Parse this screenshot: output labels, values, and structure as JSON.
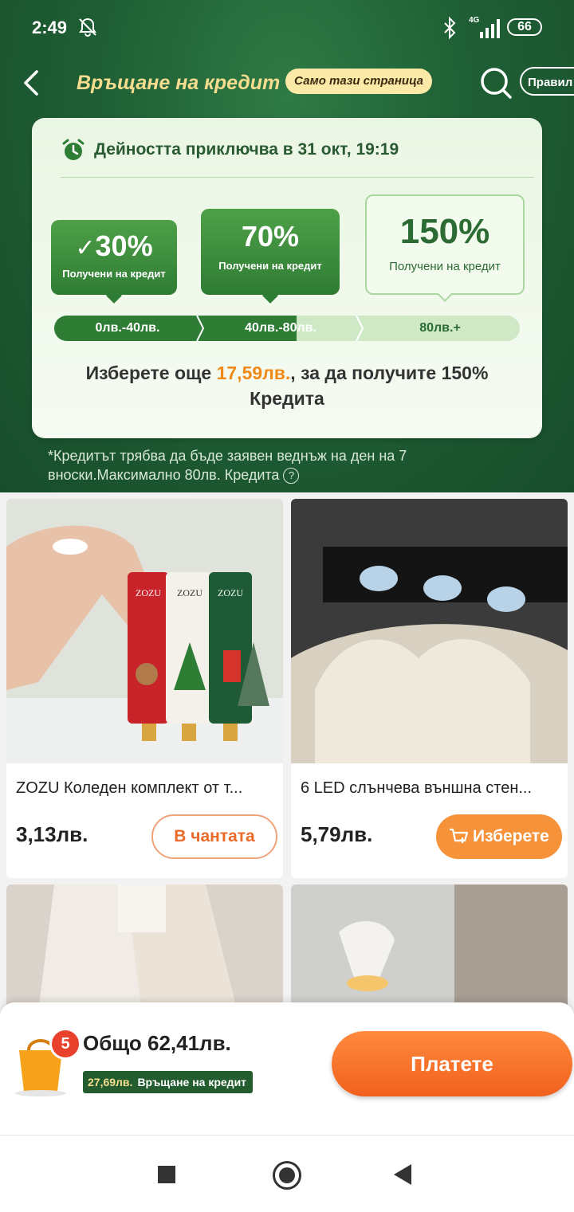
{
  "status": {
    "time": "2:49",
    "network": "4G",
    "battery": "66"
  },
  "header": {
    "title": "Връщане на кредит",
    "pill": "Само тази страница",
    "rules_label": "Правил"
  },
  "promo": {
    "ends_text": "Дейността приключва в 31 окт, 19:19",
    "tiers": [
      {
        "pct": "30%",
        "label": "Получени на кредит",
        "achieved": true
      },
      {
        "pct": "70%",
        "label": "Получени на кредит",
        "achieved": false
      },
      {
        "pct": "150%",
        "label": "Получени на кредит",
        "achieved": false
      }
    ],
    "ranges": [
      "0лв.-40лв.",
      "40лв.-80лв.",
      "80лв.+"
    ],
    "progress": 0.52,
    "msg_pre": "Изберете още ",
    "msg_amount": "17,59лв.",
    "msg_post": ", за да получите 150% Кредита",
    "note": "*Кредитът трябва да бъде заявен веднъж на ден на 7 вноски.Максимално 80лв. Кредита"
  },
  "products": [
    {
      "name": "ZOZU Коледен комплект от т...",
      "price": "3,13лв.",
      "button": "В чантата",
      "brand": "ZOZU"
    },
    {
      "name": "6 LED слънчева външна стен...",
      "price": "5,79лв.",
      "button": "Изберете"
    }
  ],
  "checkout": {
    "count": "5",
    "total": "Общо 62,41лв.",
    "credit_amount": "27,69лв.",
    "credit_label": "Връщане на кредит",
    "pay_label": "Платете"
  },
  "colors": {
    "brand_green": "#2f7c34",
    "accent_orange": "#f08a17",
    "pay_orange": "#f1601e"
  }
}
